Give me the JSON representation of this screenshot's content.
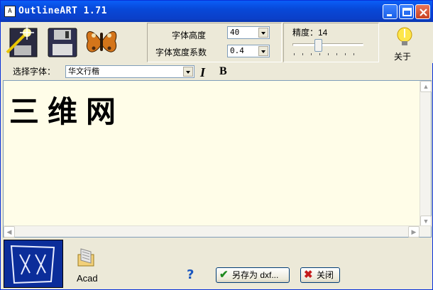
{
  "window": {
    "title": "OutlineART 1.71",
    "app_icon_glyph": "A"
  },
  "toolbar": {
    "font_height_label": "字体高度",
    "font_height_value": "40",
    "font_width_label": "字体宽度系数",
    "font_width_value": "0.4",
    "precision_label": "精度：14",
    "precision_slider_level": 0.35,
    "about_label": "关于"
  },
  "font_row": {
    "select_label": "选择字体：",
    "font_value": "华文行楷",
    "italic_label": "I",
    "bold_label": "B"
  },
  "canvas": {
    "text": "三维网"
  },
  "bottom": {
    "acad_label": "Acad",
    "help_label": "?",
    "save_label": "另存为 dxf...",
    "close_label": "关闭"
  },
  "colors": {
    "titlebar": "#0a52e8",
    "canvas_bg": "#fffde8",
    "preview_bg": "#0b2d9a"
  },
  "icons": [
    "new-file-wand-icon",
    "save-disk-icon",
    "butterfly-icon",
    "lightbulb-icon",
    "preview-glyph-icon",
    "acad-folder-icon",
    "help-icon",
    "save-check-icon",
    "close-x-icon"
  ]
}
